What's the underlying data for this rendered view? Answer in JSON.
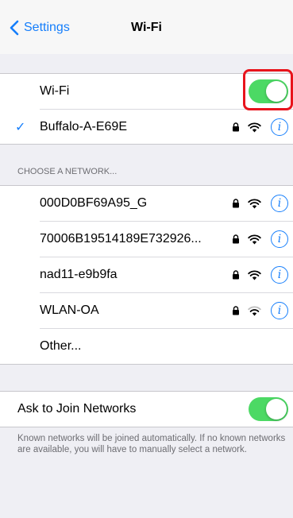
{
  "nav": {
    "back_label": "Settings",
    "title": "Wi-Fi"
  },
  "wifi_toggle": {
    "label": "Wi-Fi",
    "on": true
  },
  "connected": {
    "name": "Buffalo-A-E69E",
    "locked": true,
    "info_icon": "info-icon"
  },
  "section_header": "CHOOSE A NETWORK...",
  "networks": [
    {
      "name": "000D0BF69A95_G",
      "locked": true
    },
    {
      "name": "70006B19514189E732926...",
      "locked": true
    },
    {
      "name": "nad11-e9b9fa",
      "locked": true
    },
    {
      "name": "WLAN-OA",
      "locked": true
    }
  ],
  "other_label": "Other...",
  "ask_to_join": {
    "label": "Ask to Join Networks",
    "on": true,
    "footer": "Known networks will be joined automatically. If no known networks are available, you will have to manually select a network."
  },
  "colors": {
    "accent": "#157efb",
    "toggle_on": "#4cd964",
    "highlight": "#e8141c"
  },
  "info_glyph": "i"
}
